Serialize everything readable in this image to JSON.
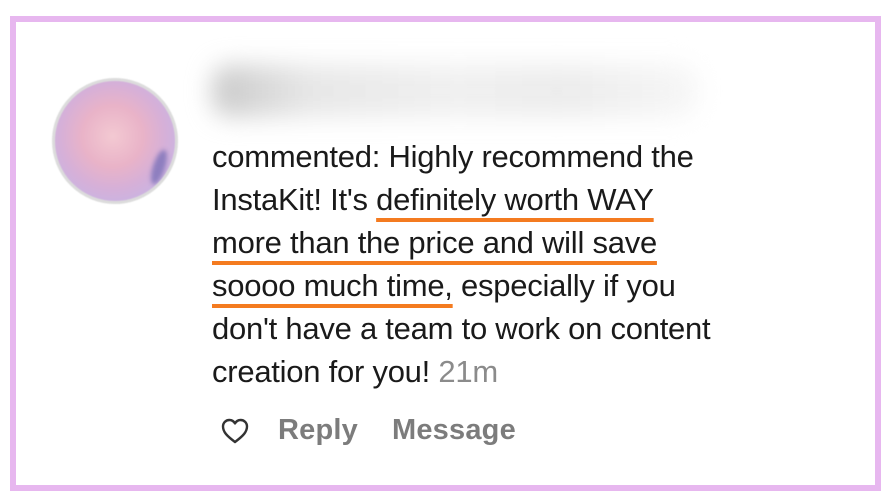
{
  "comment": {
    "username_blurred": "",
    "lines": [
      "commented: Highly recommend the",
      "InstaKit! It's ",
      "definitely worth WAY",
      "more than the price and will save",
      "soooo much time,",
      " especially if you",
      "don't have a team to work on content",
      "creation for you!"
    ],
    "timestamp": "21m"
  },
  "actions": {
    "like_icon": "heart-icon",
    "reply_label": "Reply",
    "message_label": "Message"
  },
  "colors": {
    "frame": "#e7b7ef",
    "underline": "#f47b20",
    "text": "#1a1a1a",
    "muted": "#8b8b8b"
  }
}
